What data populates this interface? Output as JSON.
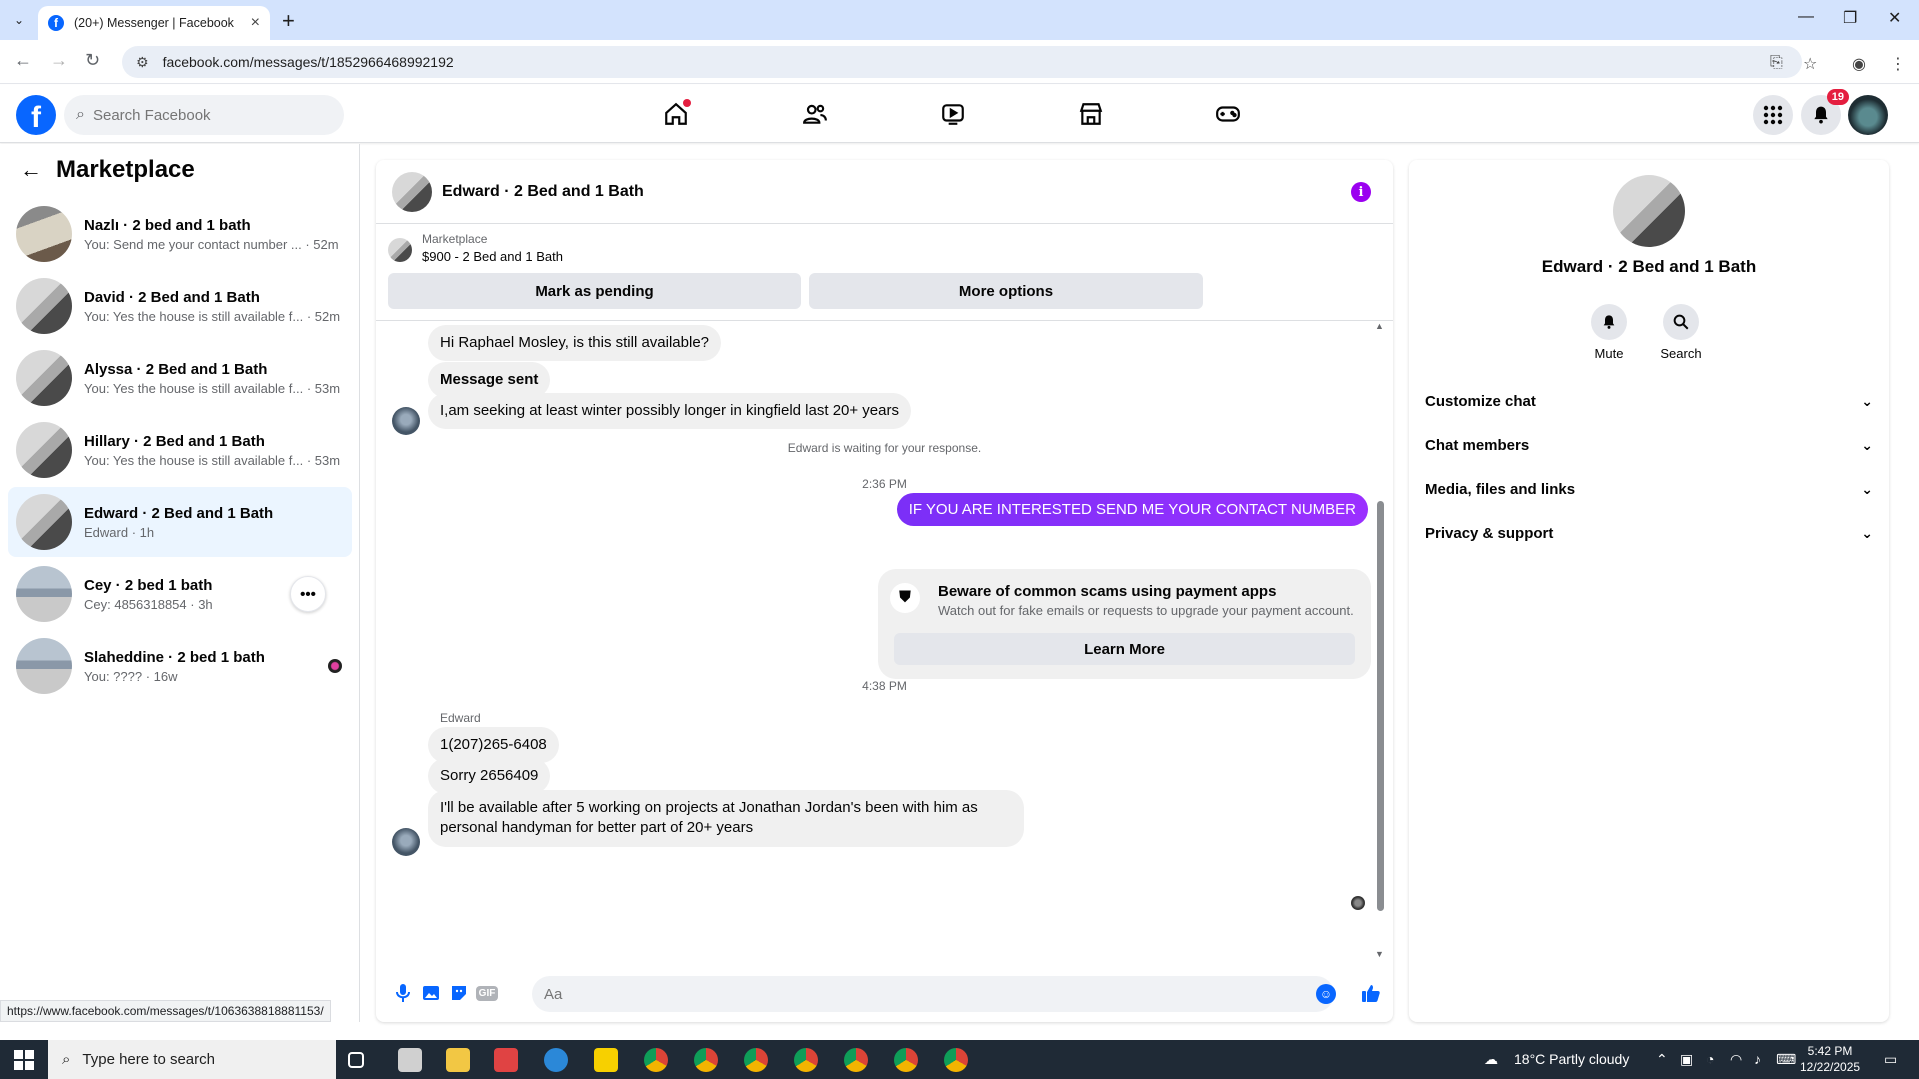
{
  "browser": {
    "tab_title": "(20+) Messenger | Facebook",
    "url": "facebook.com/messages/t/1852966468992192",
    "status_url": "https://www.facebook.com/messages/t/1063638818881153/"
  },
  "fb": {
    "search_placeholder": "Search Facebook",
    "notifications_count": "19"
  },
  "left": {
    "title": "Marketplace",
    "conversations": [
      {
        "name": "Nazlı · 2 bed and 1 bath",
        "preview": "You: Send me your contact number ... · 52m"
      },
      {
        "name": "David · 2 Bed and 1 Bath",
        "preview": "You: Yes the house is still available f... · 52m"
      },
      {
        "name": "Alyssa · 2 Bed and 1 Bath",
        "preview": "You: Yes the house is still available f... · 53m"
      },
      {
        "name": "Hillary · 2 Bed and 1 Bath",
        "preview": "You: Yes the house is still available f... · 53m"
      },
      {
        "name": "Edward · 2 Bed and 1 Bath",
        "preview": "Edward · 1h"
      },
      {
        "name": "Cey · 2 bed 1 bath",
        "preview": "Cey: 4856318854 · 3h"
      },
      {
        "name": "Slaheddine · 2 bed 1 bath",
        "preview": "You: ???? · 16w"
      }
    ],
    "more_glyph": "•••"
  },
  "chat": {
    "header_name": "Edward · 2 Bed and 1 Bath",
    "listing_source": "Marketplace",
    "listing_title": "$900 - 2 Bed and 1 Bath",
    "mark_pending": "Mark as pending",
    "more_options": "More options",
    "messages": {
      "m1": "Hi Raphael Mosley, is this still available?",
      "m2": "Message sent",
      "m3": "I,am seeking at least winter possibly longer in kingfield last 20+ years",
      "waiting": "Edward is waiting for your response.",
      "time1": "2:36 PM",
      "out1": "IF YOU ARE INTERESTED SEND ME YOUR CONTACT NUMBER",
      "scam_title": "Beware of common scams using payment apps",
      "scam_desc": "Watch out for fake emails or requests to upgrade your payment account.",
      "learn_more": "Learn More",
      "time2": "4:38 PM",
      "sender": "Edward",
      "m4": "1(207)265-6408",
      "m5": "Sorry 2656409",
      "m6": "I'll be available after 5 working on projects at Jonathan Jordan's been with him as personal handyman for better part of 20+ years"
    },
    "composer_placeholder": "Aa",
    "gif_label": "GIF"
  },
  "info": {
    "name": "Edward · 2 Bed and 1 Bath",
    "mute": "Mute",
    "search": "Search",
    "rows": [
      "Customize chat",
      "Chat members",
      "Media, files and links",
      "Privacy & support"
    ]
  },
  "taskbar": {
    "search_placeholder": "Type here to search",
    "weather": "18°C  Partly cloudy",
    "time": "5:42 PM",
    "date": "12/22/2025"
  }
}
